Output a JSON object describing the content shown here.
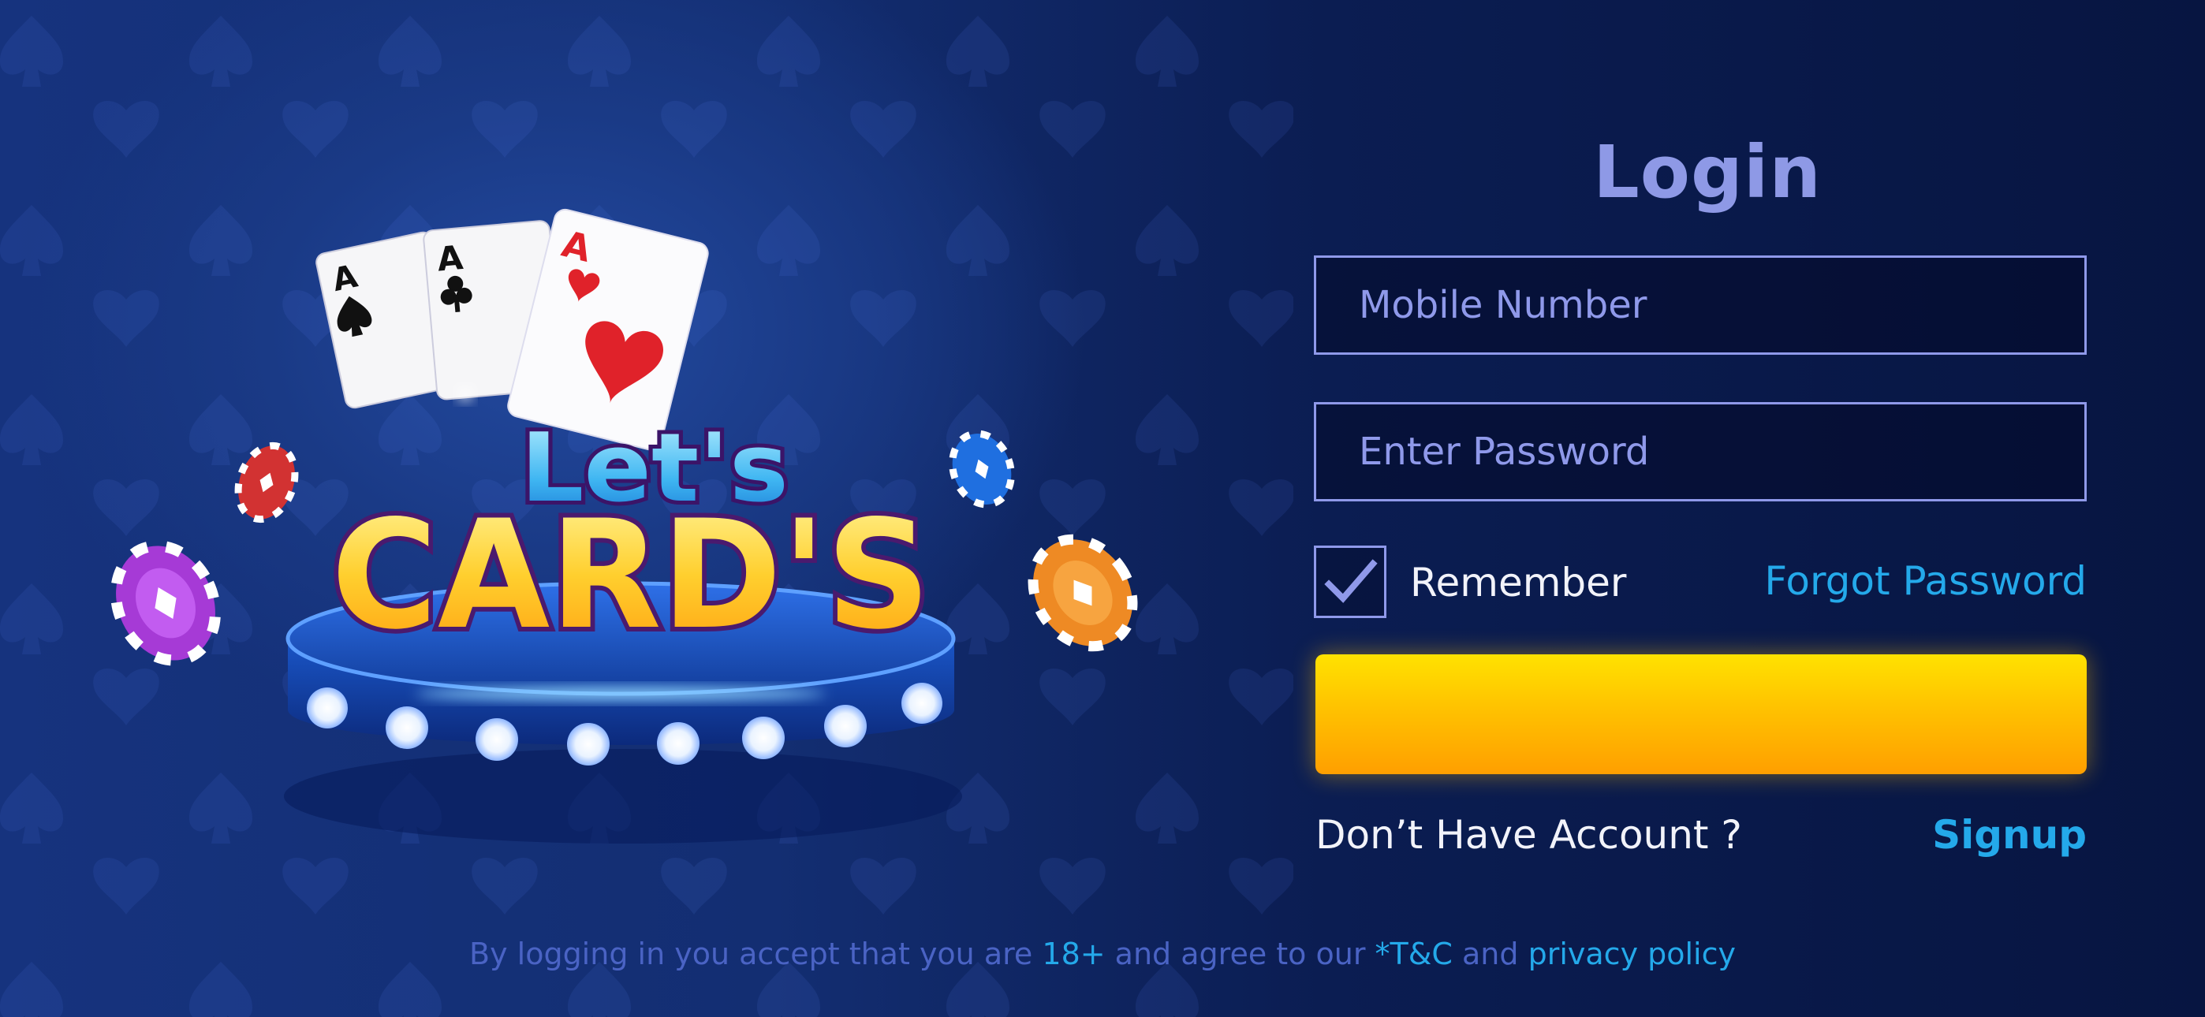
{
  "logo": {
    "line1": "Let's",
    "line2": "CARD'S",
    "card_ranks": [
      "A",
      "A",
      "A"
    ],
    "card_suits": [
      "spade-icon",
      "club-icon",
      "heart-icon"
    ]
  },
  "login": {
    "title": "Login",
    "mobile_placeholder": "Mobile Number",
    "password_placeholder": "Enter Password",
    "remember_label": "Remember",
    "remember_checked": true,
    "forgot_label": "Forgot Password",
    "login_button_label": "",
    "no_account_text": "Don’t Have Account ?",
    "signup_label": "Signup"
  },
  "footer": {
    "prefix": "By logging in you accept that you are ",
    "age": "18+",
    "middle": " and agree to our ",
    "tnc": "*T&C",
    "and": " and ",
    "privacy": "privacy policy"
  },
  "colors": {
    "accent_blue": "#24a9ea",
    "title_lavender": "#8e99e6",
    "button_yellow": "#ffc200",
    "button_orange": "#ff9f00",
    "logo_gold": "#ffc21a"
  }
}
